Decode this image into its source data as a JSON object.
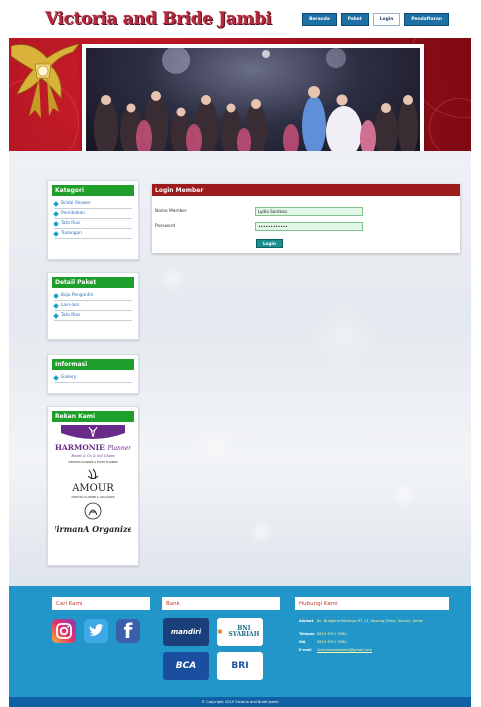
{
  "site": {
    "title": "Victoria and Bride Jambi"
  },
  "nav": [
    {
      "label": "Beranda",
      "active": false
    },
    {
      "label": "Paket",
      "active": false
    },
    {
      "label": "Login",
      "active": true
    },
    {
      "label": "Pendaftaran",
      "active": false
    }
  ],
  "slider": {
    "dots": 5,
    "active_index": 0
  },
  "sidebar": {
    "kategori": {
      "title": "Kategori",
      "items": [
        "Bridal Shower",
        "Pernikahan",
        "Tata Rias",
        "Tunangan"
      ]
    },
    "detail_paket": {
      "title": "Detail Paket",
      "items": [
        "Baju Pengantin",
        "Lain-lain",
        "Tata Rias"
      ]
    },
    "informasi": {
      "title": "Informasi",
      "items": [
        "Gallery"
      ]
    },
    "rekan_kami": {
      "title": "Rekan Kami",
      "partners": [
        {
          "name": "HARMONIE Planner",
          "tagline": "Event & Co & Sol Chara",
          "sub": "WEDDING PLANNER & EVENT PLANNER"
        },
        {
          "name": "AMOUR",
          "sub": "WEDDING PLANNER & ORGANIZER"
        },
        {
          "name": "NirmanA Organizer"
        }
      ]
    }
  },
  "login": {
    "title": "Login Member",
    "fields": [
      {
        "label": "Nama Member",
        "value": "Lydia Santoso"
      },
      {
        "label": "Password",
        "value": "••••••••••••"
      }
    ],
    "button": "Login"
  },
  "footer": {
    "cari_kami": {
      "title": "Cari Kami",
      "social": [
        "instagram",
        "twitter",
        "facebook"
      ]
    },
    "bank": {
      "title": "Bank",
      "banks": [
        "mandiri",
        "BNI SYARIAH",
        "BCA",
        "BRI"
      ]
    },
    "hubungi": {
      "title": "Hubungi Kami",
      "rows": [
        {
          "key": "Alamat",
          "value": "Jln. Bridgend Kotamas RT. 11, Kasang (Simp. Sonan), Jambi"
        },
        {
          "key": "Telepon",
          "value": "0819 3911 5382"
        },
        {
          "key": "WA",
          "value": "0819 3911 5382"
        },
        {
          "key": "E-mail",
          "value": "victoriabridejambi@gmail.com"
        }
      ]
    },
    "copyright": "© Copyright 2019 Victoria and Bride Jambi"
  },
  "colors": {
    "brand": "#b32a3e",
    "nav": "#1e6fa3",
    "sidebar_head": "#1e9e2a",
    "login_head": "#9d1a1d",
    "footer": "#2296c9",
    "copyright_bar": "#0e5fa3"
  }
}
